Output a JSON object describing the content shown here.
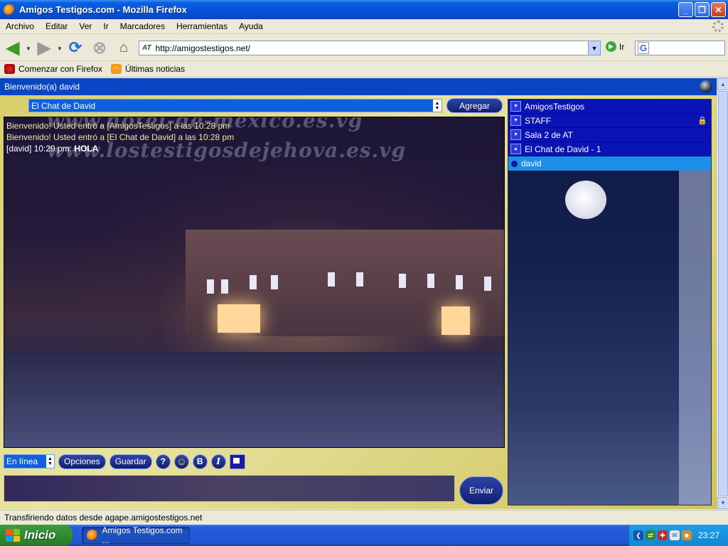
{
  "window": {
    "title": "Amigos Testigos.com - Mozilla Firefox",
    "buttons": [
      "_",
      "❐",
      "✕"
    ]
  },
  "menu": [
    "Archivo",
    "Editar",
    "Ver",
    "Ir",
    "Marcadores",
    "Herramientas",
    "Ayuda"
  ],
  "navbar": {
    "site_badge": "AT",
    "url": "http://amigostestigos.net/",
    "go_label": "Ir",
    "search_engine": "G"
  },
  "bookmarks": [
    {
      "label": "Comenzar con Firefox",
      "icon": "firefox-icon"
    },
    {
      "label": "Últimas noticias",
      "icon": "rss-icon"
    }
  ],
  "page": {
    "welcome": "Bienvenido(a) david"
  },
  "chat": {
    "room_selected": "El Chat de David",
    "add_label": "Agregar",
    "watermarks": [
      "www.hotel-de-mexico.es.vg",
      "www.lostestigosdejehova.es.vg"
    ],
    "messages": [
      {
        "type": "system",
        "text": "Bienvenido! Usted entró a [AmigosTestigos] a las 10:28 pm"
      },
      {
        "type": "system",
        "text": "Bienvenido! Usted entró a [El Chat de David] a las 10:28 pm"
      },
      {
        "type": "user",
        "prefix": "[david] 10:29 pm:",
        "text": "HOLA"
      }
    ],
    "status_selected": "En línea",
    "options_label": "Opciones",
    "save_label": "Guardar",
    "help_label": "?",
    "bold_label": "B",
    "italic_label": "I",
    "send_label": "Enviar"
  },
  "rooms": [
    {
      "name": "AmigosTestigos",
      "locked": false,
      "expanded": false
    },
    {
      "name": "STAFF",
      "locked": true,
      "expanded": false
    },
    {
      "name": "Sala 2 de AT",
      "locked": false,
      "expanded": false
    },
    {
      "name": "El Chat de David - 1",
      "locked": false,
      "expanded": true
    }
  ],
  "users": [
    "david"
  ],
  "statusbar": "Transfiriendo datos desde agape.amigostestigos.net",
  "taskbar": {
    "start_label": "Inicio",
    "task_label": "Amigos Testigos.com ...",
    "clock": "23:27"
  },
  "colors": {
    "welcome_bar": "#0a46c4",
    "room_row": "#0a14b4",
    "user_row": "#1d8fe8",
    "system_text": "#f0e7a4"
  }
}
